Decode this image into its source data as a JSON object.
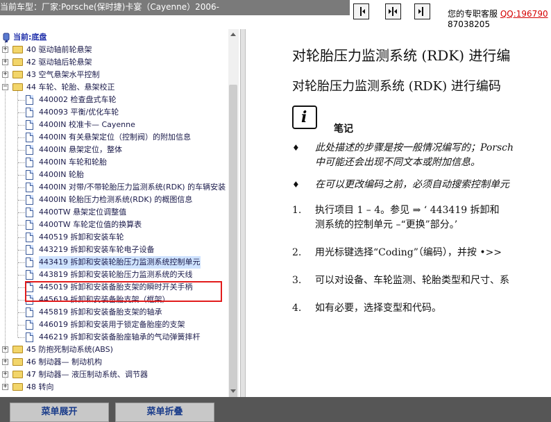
{
  "header": {
    "vehicle_title": "当前车型：厂家:Porsche(保时捷)卡宴（Cayenne）2006-",
    "nav_buttons": [
      "first-page-icon",
      "fit-page-icon",
      "last-page-icon"
    ],
    "service_label": "您的专职客服",
    "service_qq": "QQ:196790",
    "service_phone": "87038205"
  },
  "tree": {
    "root_label": "当前:底盘",
    "items": [
      {
        "label": "40 驱动轴前轮悬架",
        "type": "folder",
        "level": 1,
        "expanded": false
      },
      {
        "label": "42 驱动轴后轮悬架",
        "type": "folder",
        "level": 1,
        "expanded": false
      },
      {
        "label": "43 空气悬架水平控制",
        "type": "folder",
        "level": 1,
        "expanded": false
      },
      {
        "label": "44 车轮、轮胎、悬架校正",
        "type": "folder",
        "level": 1,
        "expanded": true
      },
      {
        "label": "440002 检查盘式车轮",
        "type": "doc",
        "level": 2
      },
      {
        "label": "440093 平衡/优化车轮",
        "type": "doc",
        "level": 2
      },
      {
        "label": "4400IN 校准卡— Cayenne",
        "type": "doc",
        "level": 2
      },
      {
        "label": "4400IN 有关悬架定位（控制阀）的附加信息",
        "type": "doc",
        "level": 2
      },
      {
        "label": "4400IN 悬架定位，整体",
        "type": "doc",
        "level": 2
      },
      {
        "label": "4400IN 车轮和轮胎",
        "type": "doc",
        "level": 2
      },
      {
        "label": "4400IN 轮胎",
        "type": "doc",
        "level": 2
      },
      {
        "label": "4400IN 对带/不带轮胎压力监测系统(RDK) 的车辆安装",
        "type": "doc",
        "level": 2
      },
      {
        "label": "4400IN 轮胎压力检测系统(RDK) 的概图信息",
        "type": "doc",
        "level": 2
      },
      {
        "label": "4400TW 悬架定位调整值",
        "type": "doc",
        "level": 2
      },
      {
        "label": "4400TW 车轮定位值的换算表",
        "type": "doc",
        "level": 2
      },
      {
        "label": "440519 拆卸和安装车轮",
        "type": "doc",
        "level": 2
      },
      {
        "label": "443219 拆卸和安装车轮电子设备",
        "type": "doc",
        "level": 2
      },
      {
        "label": "443419 拆卸和安装轮胎压力监测系统控制单元",
        "type": "doc",
        "level": 2,
        "selected": true
      },
      {
        "label": "443819 拆卸和安装轮胎压力监测系统的天线",
        "type": "doc",
        "level": 2
      },
      {
        "label": "445019 拆卸和安装备胎支架的瞬时开关手柄",
        "type": "doc",
        "level": 2
      },
      {
        "label": "445619 拆卸和安装备胎支架（框架）",
        "type": "doc",
        "level": 2
      },
      {
        "label": "445819 拆卸和安装备胎支架的轴承",
        "type": "doc",
        "level": 2
      },
      {
        "label": "446019 拆卸和安装用于锁定备胎座的支架",
        "type": "doc",
        "level": 2
      },
      {
        "label": "446219 拆卸和安装备胎座轴承的气动弹簧摔杆",
        "type": "doc",
        "level": 2
      },
      {
        "label": "45 防抱死制动系统(ABS)",
        "type": "folder",
        "level": 1,
        "expanded": false
      },
      {
        "label": "46 制动器— 制动机构",
        "type": "folder",
        "level": 1,
        "expanded": false
      },
      {
        "label": "47 制动器— 液压制动系统、调节器",
        "type": "folder",
        "level": 1,
        "expanded": false
      },
      {
        "label": "48 转向",
        "type": "folder",
        "level": 1,
        "expanded": false
      }
    ]
  },
  "document": {
    "heading1": "对轮胎压力监测系统 (RDK) 进行编",
    "heading2": "对轮胎压力监测系统 (RDK) 进行编码",
    "note_icon_char": "i",
    "note_title": "笔记",
    "bullet_char": "♦",
    "bullets": [
      [
        "此处描述的步骤是按一般情况编写的；Porsch",
        "中可能还会出现不同文本或附加信息。"
      ],
      [
        "在可以更改编码之前，必须自动搜索控制单元"
      ]
    ],
    "steps": [
      {
        "num": "1.",
        "lines": [
          "执行项目 1 – 4。参见 ⇒ ‘ 443419 拆卸和",
          "测系统的控制单元 –“更换”部分。’"
        ]
      },
      {
        "num": "2.",
        "lines": [
          "用光标键选择“Coding”（编码），并按 •>>"
        ]
      },
      {
        "num": "3.",
        "lines": [
          "可以对设备、车轮监测、轮胎类型和尺寸、系"
        ]
      },
      {
        "num": "4.",
        "lines": [
          "如有必要，选择变型和代码。"
        ]
      }
    ]
  },
  "footer": {
    "expand_label": "菜单展开",
    "collapse_label": "菜单折叠"
  },
  "colors": {
    "title_bar": "#7a7a7a",
    "footer_bar": "#565656",
    "highlight_border": "#e21b1b",
    "footer_button_text": "#1a3c8a",
    "qq_link": "#d40000"
  }
}
